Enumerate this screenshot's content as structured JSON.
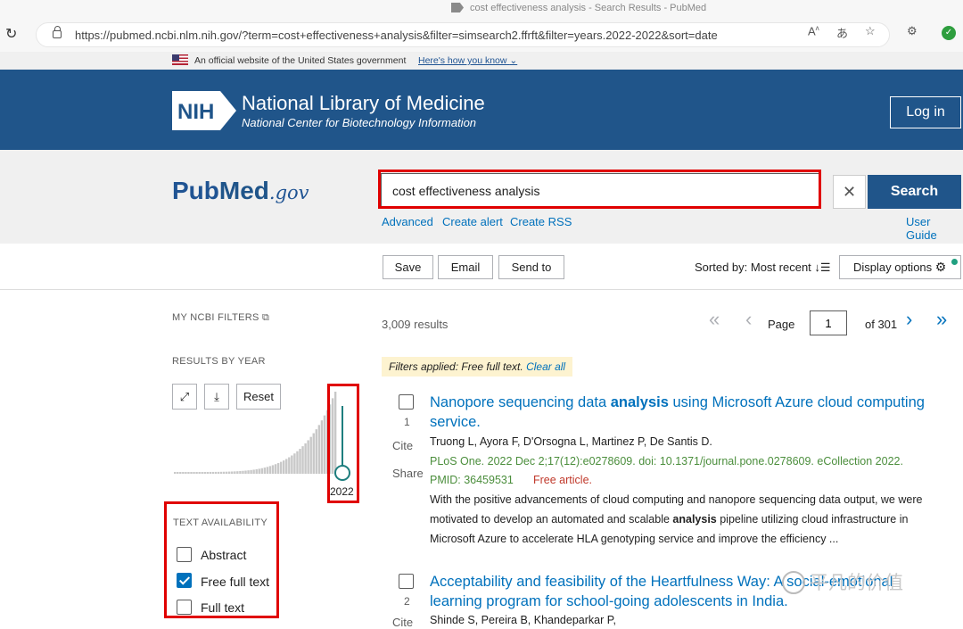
{
  "browser": {
    "tab_title": "cost effectiveness analysis - Search Results - PubMed",
    "url": "https://pubmed.ncbi.nlm.nih.gov/?term=cost+effectiveness+analysis&filter=simsearch2.ffrft&filter=years.2022-2022&sort=date"
  },
  "gov_banner": {
    "text": "An official website of the United States government",
    "link": "Here's how you know"
  },
  "nlm": {
    "logo_text": "NIH",
    "title": "National Library of Medicine",
    "subtitle": "National Center for Biotechnology Information",
    "login": "Log in"
  },
  "search": {
    "logo_pub": "Pub",
    "logo_med": "Med",
    "logo_gov": ".gov",
    "query": "cost effectiveness analysis",
    "button": "Search",
    "links": [
      "Advanced",
      "Create alert",
      "Create RSS"
    ],
    "user_guide": "User Guide"
  },
  "toolbar": {
    "save": "Save",
    "email": "Email",
    "send_to": "Send to",
    "sorted": "Sorted by: Most recent",
    "display_options": "Display options"
  },
  "sidebar": {
    "my_filters": "MY NCBI FILTERS",
    "results_by_year": "RESULTS BY YEAR",
    "reset": "Reset",
    "year": "2022",
    "text_availability": "TEXT AVAILABILITY",
    "options": [
      {
        "label": "Abstract",
        "checked": false
      },
      {
        "label": "Free full text",
        "checked": true
      },
      {
        "label": "Full text",
        "checked": false
      }
    ]
  },
  "results": {
    "count": "3,009 results",
    "page_label": "Page",
    "page": "1",
    "of": "of 301",
    "filters_applied": "Filters applied: Free full text.",
    "clear_all": "Clear all",
    "cite": "Cite",
    "share": "Share",
    "items": [
      {
        "num": "1",
        "title_a": "Nanopore sequencing data ",
        "title_b": "analysis",
        "title_c": " using Microsoft Azure cloud computing service.",
        "authors": "Truong L, Ayora F, D'Orsogna L, Martinez P, De Santis D.",
        "journal": "PLoS One. 2022 Dec 2;17(12):e0278609. doi: 10.1371/journal.pone.0278609. eCollection 2022.",
        "pmid": "PMID: 36459531",
        "free": "Free article.",
        "snippet_a": "With the positive advancements of cloud computing and nanopore sequencing data output, we were motivated to develop an automated and scalable ",
        "snippet_b": "analysis",
        "snippet_c": " pipeline utilizing cloud infrastructure in Microsoft Azure to accelerate HLA genotyping service and improve the efficiency ..."
      },
      {
        "num": "2",
        "title": "Acceptability and feasibility of the Heartfulness Way: A social-emotional learning program for school-going adolescents in India.",
        "authors": "Shinde S, Pereira B, Khandeparkar P,"
      }
    ]
  },
  "watermark": "平凡的价值",
  "colors": {
    "nlm_blue": "#20558a",
    "link_blue": "#0071bc",
    "highlight_red": "#e00000",
    "slider_teal": "#1e7e7e"
  }
}
